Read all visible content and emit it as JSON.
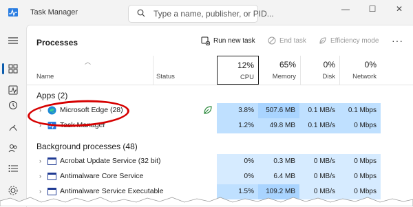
{
  "window": {
    "title": "Task Manager",
    "search_placeholder": "Type a name, publisher, or PID...",
    "controls": [
      "—",
      "☐",
      "✕"
    ]
  },
  "toolbar": {
    "page_title": "Processes",
    "run_new_task": "Run new task",
    "end_task": "End task",
    "efficiency_mode": "Efficiency mode",
    "more": "···"
  },
  "header": {
    "name": "Name",
    "status": "Status",
    "cpu": {
      "pct": "12%",
      "label": "CPU"
    },
    "memory": {
      "pct": "65%",
      "label": "Memory"
    },
    "disk": {
      "pct": "0%",
      "label": "Disk"
    },
    "network": {
      "pct": "0%",
      "label": "Network"
    }
  },
  "groups": {
    "apps": "Apps (2)",
    "background": "Background processes (48)"
  },
  "rows": [
    {
      "name": "Microsoft Edge (28)",
      "cpu": "3.8%",
      "memory": "507.6 MB",
      "disk": "0.1 MB/s",
      "network": "0.1 Mbps",
      "icon": "edge-icon",
      "status_icon": "efficiency-leaf-icon"
    },
    {
      "name": "Task Manager",
      "cpu": "1.2%",
      "memory": "49.8 MB",
      "disk": "0.1 MB/s",
      "network": "0 Mbps",
      "icon": "task-manager-icon"
    },
    {
      "name": "Acrobat Update Service (32 bit)",
      "cpu": "0%",
      "memory": "0.3 MB",
      "disk": "0 MB/s",
      "network": "0 Mbps",
      "icon": "service-icon"
    },
    {
      "name": "Antimalware Core Service",
      "cpu": "0%",
      "memory": "6.4 MB",
      "disk": "0 MB/s",
      "network": "0 Mbps",
      "icon": "service-icon"
    },
    {
      "name": "Antimalware Service Executable",
      "cpu": "1.5%",
      "memory": "109.2 MB",
      "disk": "0 MB/s",
      "network": "0 Mbps",
      "icon": "service-icon"
    }
  ],
  "colors": {
    "accent": "#0b5cad",
    "heat_light": "#d6ebff",
    "heat_mid": "#bfe0ff",
    "heat_strong": "#a9d4ff",
    "annotation": "#d60000"
  }
}
